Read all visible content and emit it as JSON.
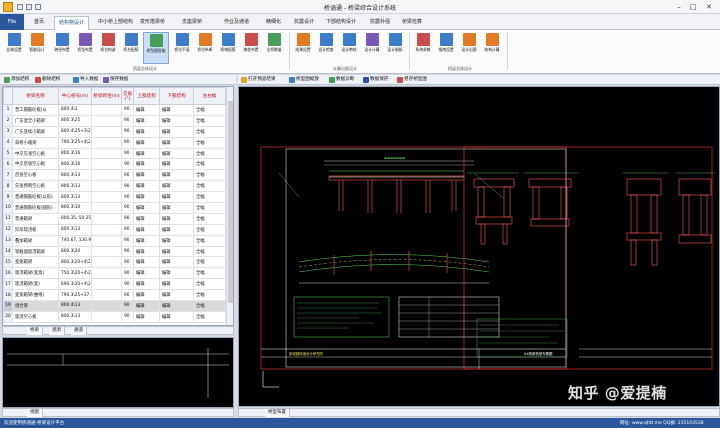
{
  "app": {
    "title": "桥涵通 - 桥梁综合设计系统"
  },
  "menu_tabs": [
    "File",
    "首页",
    "结构物设计",
    "中小桥上部结构",
    "变形搭梁桥",
    "支座梁桥",
    "作业及通道",
    "精细化",
    "抗震设计",
    "下部结构设计",
    "抗震补强",
    "桥梁检算"
  ],
  "ribbon": {
    "buttons": [
      {
        "label": "总体设置",
        "color": "#3d7cc9"
      },
      {
        "label": "智能设计",
        "color": "#e07b24"
      },
      {
        "label": "跨径布置",
        "color": "#3d7cc9"
      },
      {
        "label": "桥型布置",
        "color": "#7a58b8"
      },
      {
        "label": "桥台构造",
        "color": "#c94d4d"
      },
      {
        "label": "桥台配筋",
        "color": "#3d7cc9"
      },
      {
        "label": "桥型图智能",
        "color": "#4a9e5c"
      },
      {
        "label": "桥位平面",
        "color": "#3d7cc9"
      },
      {
        "label": "桥位纵断",
        "color": "#e07b24"
      },
      {
        "label": "桥墩配筋",
        "color": "#3d7cc9"
      },
      {
        "label": "墩柱布置",
        "color": "#c94d4d"
      },
      {
        "label": "全桥数量",
        "color": "#4a9e5c"
      },
      {
        "label": "成果设置",
        "color": "#e07b24"
      },
      {
        "label": "设计检查",
        "color": "#3d7cc9"
      },
      {
        "label": "设计审核",
        "color": "#3d7cc9"
      },
      {
        "label": "设计计算",
        "color": "#7a58b8"
      },
      {
        "label": "设计图纸",
        "color": "#3d7cc9"
      },
      {
        "label": "系统参数",
        "color": "#c94d4d"
      },
      {
        "label": "指南设置",
        "color": "#3d7cc9"
      },
      {
        "label": "设计出图",
        "color": "#e07b24"
      },
      {
        "label": "结构计算",
        "color": "#e07b24"
      }
    ],
    "groups": [
      "桥梁总体设计",
      "桥型图设计",
      "计算出图设计",
      "桥梁总体设计"
    ]
  },
  "left_toolbar": {
    "add": "添加结构",
    "delete": "删除结构",
    "import": "导入数据",
    "save": "保存数据"
  },
  "table": {
    "headers": [
      "桥梁名称",
      "中心桩号(m)",
      "桥梁跨径(m)",
      "交角(°)",
      "上部结构",
      "下部结构",
      "左右幅"
    ],
    "rows": [
      [
        "普工钢筋砼板(以",
        "800.4\\3",
        "",
        "90",
        "编辑",
        "编辑",
        "全幅"
      ],
      [
        "广东混全小箱梁",
        "800.3\\25",
        "",
        "90",
        "编辑",
        "编辑",
        "全幅"
      ],
      [
        "广东连续小箱梁",
        "800.4\\25+3\\25",
        "",
        "90",
        "编辑",
        "编辑",
        "全幅"
      ],
      [
        "斜桥小箱梁",
        "790.3\\25+4\\25+3",
        "",
        "90",
        "编辑",
        "编辑",
        "全幅"
      ],
      [
        "中交先张空心板",
        "800.3\\16",
        "",
        "90",
        "编辑",
        "编辑",
        "全幅"
      ],
      [
        "中交后张空心板",
        "800.3\\16",
        "",
        "90",
        "编辑",
        "编辑",
        "全幅"
      ],
      [
        "后张空心板",
        "800.3\\13",
        "",
        "90",
        "编辑",
        "编辑",
        "全幅"
      ],
      [
        "先张预制空心板",
        "800.3\\13",
        "",
        "90",
        "编辑",
        "编辑",
        "全幅"
      ],
      [
        "普通钢筋砼板(以形)",
        "800.3\\13",
        "",
        "90",
        "编辑",
        "编辑",
        "全幅"
      ],
      [
        "普通钢筋砼板(圆形)",
        "800.3\\10",
        "",
        "90",
        "编辑",
        "编辑",
        "全幅"
      ],
      [
        "普通箱梁",
        "800.35, 50.35",
        "",
        "90",
        "编辑",
        "编辑",
        "全幅"
      ],
      [
        "异形现浇板",
        "800.3\\13",
        "",
        "90",
        "编辑",
        "编辑",
        "全幅"
      ],
      [
        "叠加箱梁",
        "740.67, 130.97",
        "",
        "90",
        "编辑",
        "编辑",
        "全幅"
      ],
      [
        "等截面现浇箱梁",
        "800.3\\20",
        "",
        "90",
        "编辑",
        "编辑",
        "全幅"
      ],
      [
        "变宽箱梁",
        "800.3\\20+4\\25+4",
        "",
        "90",
        "编辑",
        "编辑",
        "全幅"
      ],
      [
        "现浇箱梁(变高)",
        "750.3\\20+4\\25+4",
        "",
        "90",
        "编辑",
        "编辑",
        "全幅"
      ],
      [
        "现浇箱梁(变)",
        "690.3\\20+4\\25+4",
        "",
        "90",
        "编辑",
        "编辑",
        "全幅"
      ],
      [
        "变宽箱梁(曲线)",
        "790.3\\25+37.60",
        "",
        "90",
        "编辑",
        "编辑",
        "全幅"
      ],
      [
        "组合梁",
        "800.4\\13",
        "",
        "90",
        "编辑",
        "编辑",
        "全幅"
      ],
      [
        "现浇空心板",
        "800.3\\13",
        "",
        "90",
        "编辑",
        "编辑",
        "全幅"
      ]
    ],
    "selected_row": 19
  },
  "left_sheet_tabs": [
    "桥梁",
    "涵洞",
    "通道"
  ],
  "mini_tabs": [
    "视图"
  ],
  "right_toolbar": [
    "打开预览结果",
    "桥型图缩放",
    "数据诊断",
    "数据保存",
    "另存桥型图"
  ],
  "canvas_tabs": [
    "桥型布置"
  ],
  "drawing": {
    "title_block": "某城镇桥涵设计研究院",
    "sheet_title": "XX桥梁桥型布置图"
  },
  "status": {
    "left": "欢迎使用桥涵通-桥梁设计平台",
    "right": "网址: www.qhtt.me QQ群: 235103538"
  },
  "watermark": "知乎 @爱提楠"
}
